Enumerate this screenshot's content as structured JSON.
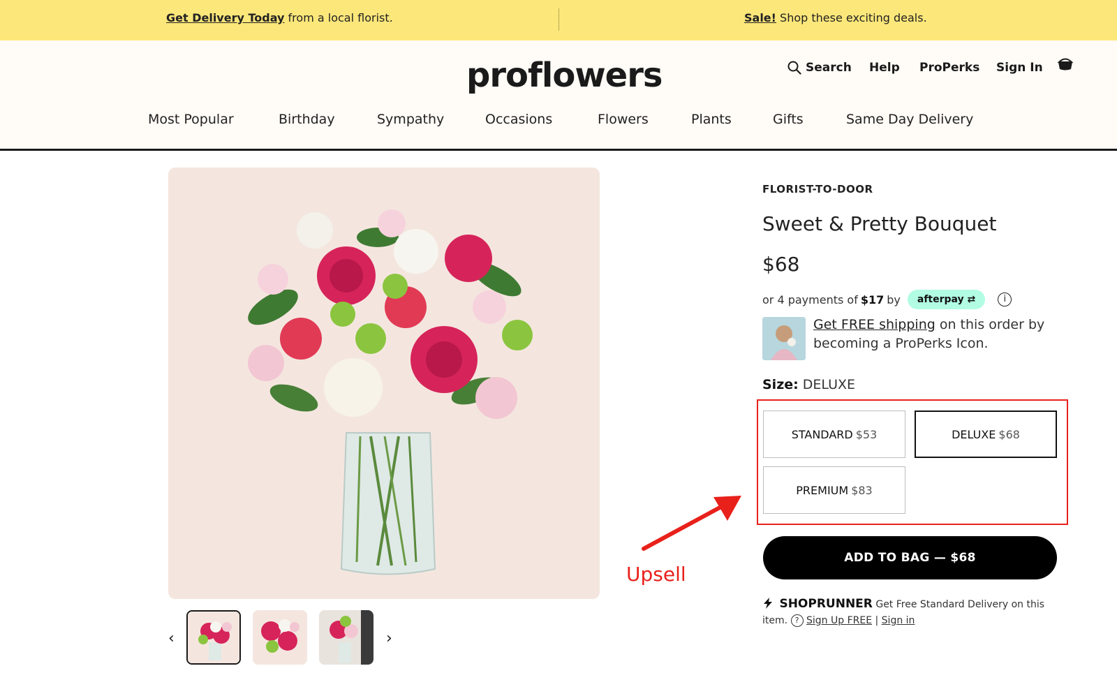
{
  "promo": {
    "left_bold": "Get Delivery Today",
    "left_rest": " from a local florist.",
    "right_bold": "Sale!",
    "right_rest": " Shop these exciting deals."
  },
  "header": {
    "logo": "proflowers",
    "search": "Search",
    "help": "Help",
    "perks": "ProPerks",
    "signin": "Sign In"
  },
  "nav": [
    {
      "label": "Most Popular"
    },
    {
      "label": "Birthday"
    },
    {
      "label": "Sympathy"
    },
    {
      "label": "Occasions"
    },
    {
      "label": "Flowers"
    },
    {
      "label": "Plants"
    },
    {
      "label": "Gifts"
    },
    {
      "label": "Same Day Delivery"
    }
  ],
  "product": {
    "eyebrow": "FLORIST-TO-DOOR",
    "title": "Sweet & Pretty Bouquet",
    "price": "$68",
    "afterpay_prefix": "or 4 payments of",
    "afterpay_amount": "$17",
    "afterpay_by": "by",
    "afterpay_brand": "afterpay",
    "perks_link": "Get FREE shipping",
    "perks_rest": " on this order by becoming a ProPerks Icon.",
    "size_label": "Size:",
    "size_value": "DELUXE",
    "sizes": [
      {
        "name": "STANDARD",
        "price": "$53"
      },
      {
        "name": "DELUXE",
        "price": "$68"
      },
      {
        "name": "PREMIUM",
        "price": "$83"
      }
    ],
    "add_to_bag": "ADD TO BAG — $68"
  },
  "shoprunner": {
    "brand": "SHOPRUNNER",
    "text": " Get Free Standard Delivery on this item.",
    "signup": "Sign Up FREE",
    "sep": "|",
    "signin": "Sign in"
  },
  "annotation": {
    "label": "Upsell"
  },
  "colors": {
    "promo_bg": "#fce77a",
    "annotation_red": "#e8211b",
    "afterpay_mint": "#b2fce4"
  }
}
